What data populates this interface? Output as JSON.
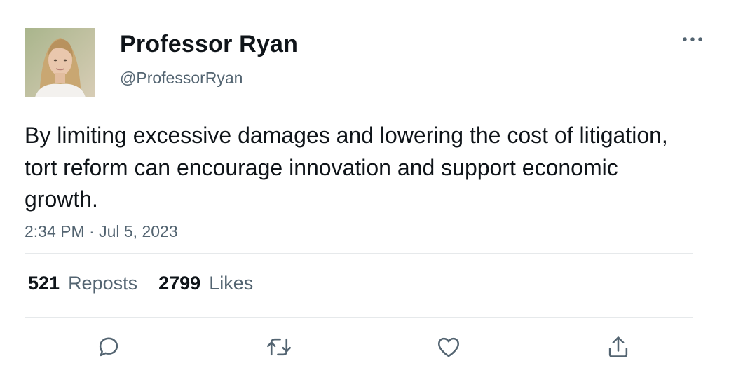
{
  "author": {
    "display_name": "Professor Ryan",
    "handle": "@ProfessorRyan",
    "avatar_icon": "profile-photo"
  },
  "tweet": {
    "text": "By limiting excessive damages and lowering the cost of litigation, tort reform can encourage innovation and support economic growth.",
    "timestamp": "2:34 PM · Jul 5, 2023"
  },
  "stats": {
    "reposts_count": "521",
    "reposts_label": "Reposts",
    "likes_count": "2799",
    "likes_label": "Likes"
  },
  "actions": {
    "reply_icon": "reply-icon",
    "repost_icon": "repost-icon",
    "like_icon": "heart-icon",
    "share_icon": "share-icon"
  },
  "menu": {
    "more_icon": "more-dots-icon"
  },
  "colors": {
    "text_primary": "#0f1419",
    "text_secondary": "#536471",
    "divider": "#e6e9eb"
  }
}
